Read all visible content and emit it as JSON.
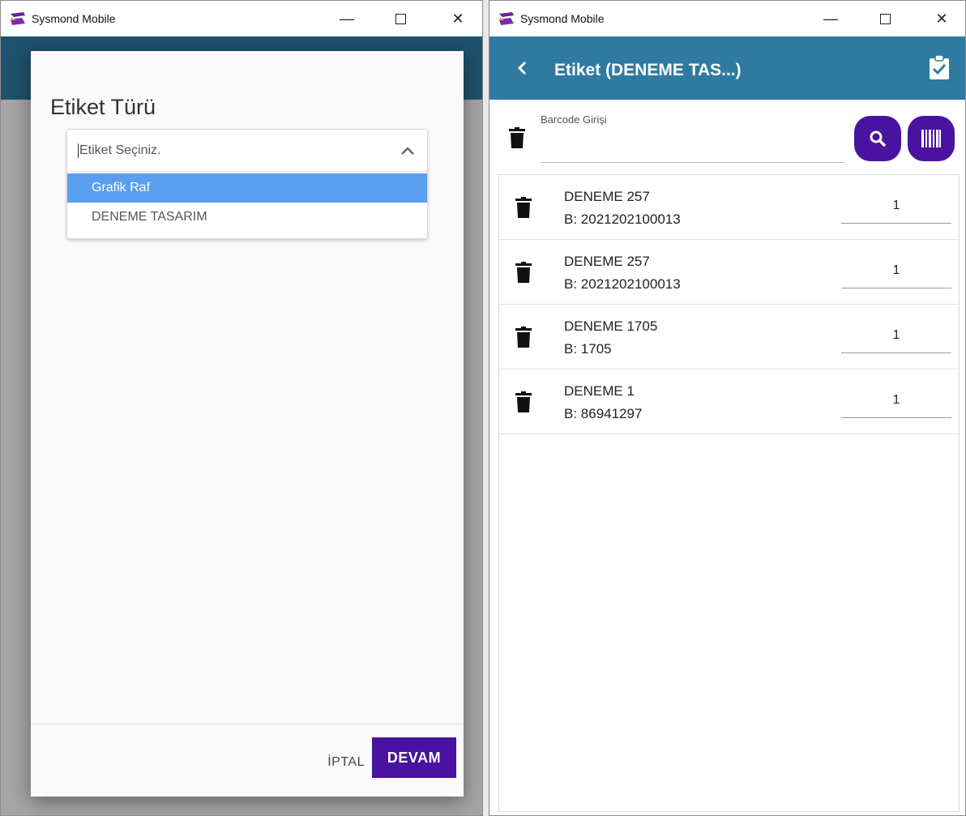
{
  "left_window": {
    "app_title": "Sysmond Mobile",
    "dialog": {
      "title": "Etiket Türü",
      "select_placeholder": "Etiket Seçiniz.",
      "options": [
        "Grafik Raf",
        "DENEME TASARIM"
      ],
      "selected_index": 0,
      "cancel_label": "İPTAL",
      "continue_label": "DEVAM"
    }
  },
  "right_window": {
    "app_title": "Sysmond Mobile",
    "page_title": "Etiket (DENEME TAS...)",
    "barcode_label": "Barcode Girişi",
    "barcode_value": "",
    "items": [
      {
        "name": "DENEME 257",
        "barcode": "B: 2021202100013",
        "qty": "1"
      },
      {
        "name": "DENEME 257",
        "barcode": "B: 2021202100013",
        "qty": "1"
      },
      {
        "name": "DENEME 1705",
        "barcode": "B: 1705",
        "qty": "1"
      },
      {
        "name": "DENEME 1",
        "barcode": "B: 86941297",
        "qty": "1"
      }
    ]
  },
  "colors": {
    "app_bar": "#2f7aa0",
    "accent_button": "#4a12a0",
    "selected_option": "#5a9ef0"
  },
  "icons": [
    "app-logo-icon",
    "minimize-icon",
    "maximize-icon",
    "close-icon",
    "back-icon",
    "clipboard-check-icon",
    "trash-icon",
    "search-icon",
    "barcode-icon",
    "chevron-up-icon"
  ]
}
